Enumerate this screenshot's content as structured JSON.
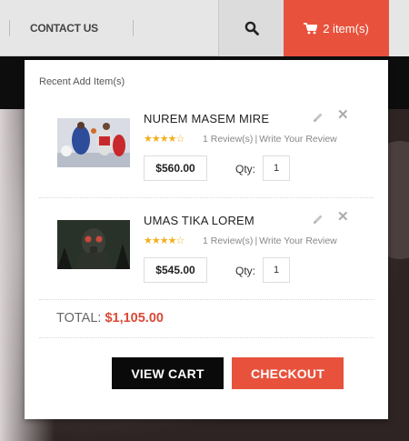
{
  "nav": {
    "contact_label": "CONTACT US",
    "cart_label": "2 item(s)"
  },
  "dropdown": {
    "title": "Recent Add Item(s)",
    "items": [
      {
        "name": "NUREM MASEM MIRE",
        "rating": 4,
        "reviews": "1 Review(s)",
        "write_review": "Write Your Review",
        "price": "$560.00",
        "qty_label": "Qty:",
        "qty": "1",
        "image": "basketball-players"
      },
      {
        "name": "UMAS TIKA LOREM",
        "rating": 4,
        "reviews": "1 Review(s)",
        "write_review": "Write Your Review",
        "price": "$545.00",
        "qty_label": "Qty:",
        "qty": "1",
        "image": "gas-mask-soldier"
      }
    ],
    "total_label": "TOTAL:",
    "total_value": "$1,105.00",
    "view_cart": "VIEW CART",
    "checkout": "CHECKOUT"
  },
  "colors": {
    "accent": "#e8523d",
    "dark": "#0a0a0a",
    "star": "#f2b01e"
  }
}
